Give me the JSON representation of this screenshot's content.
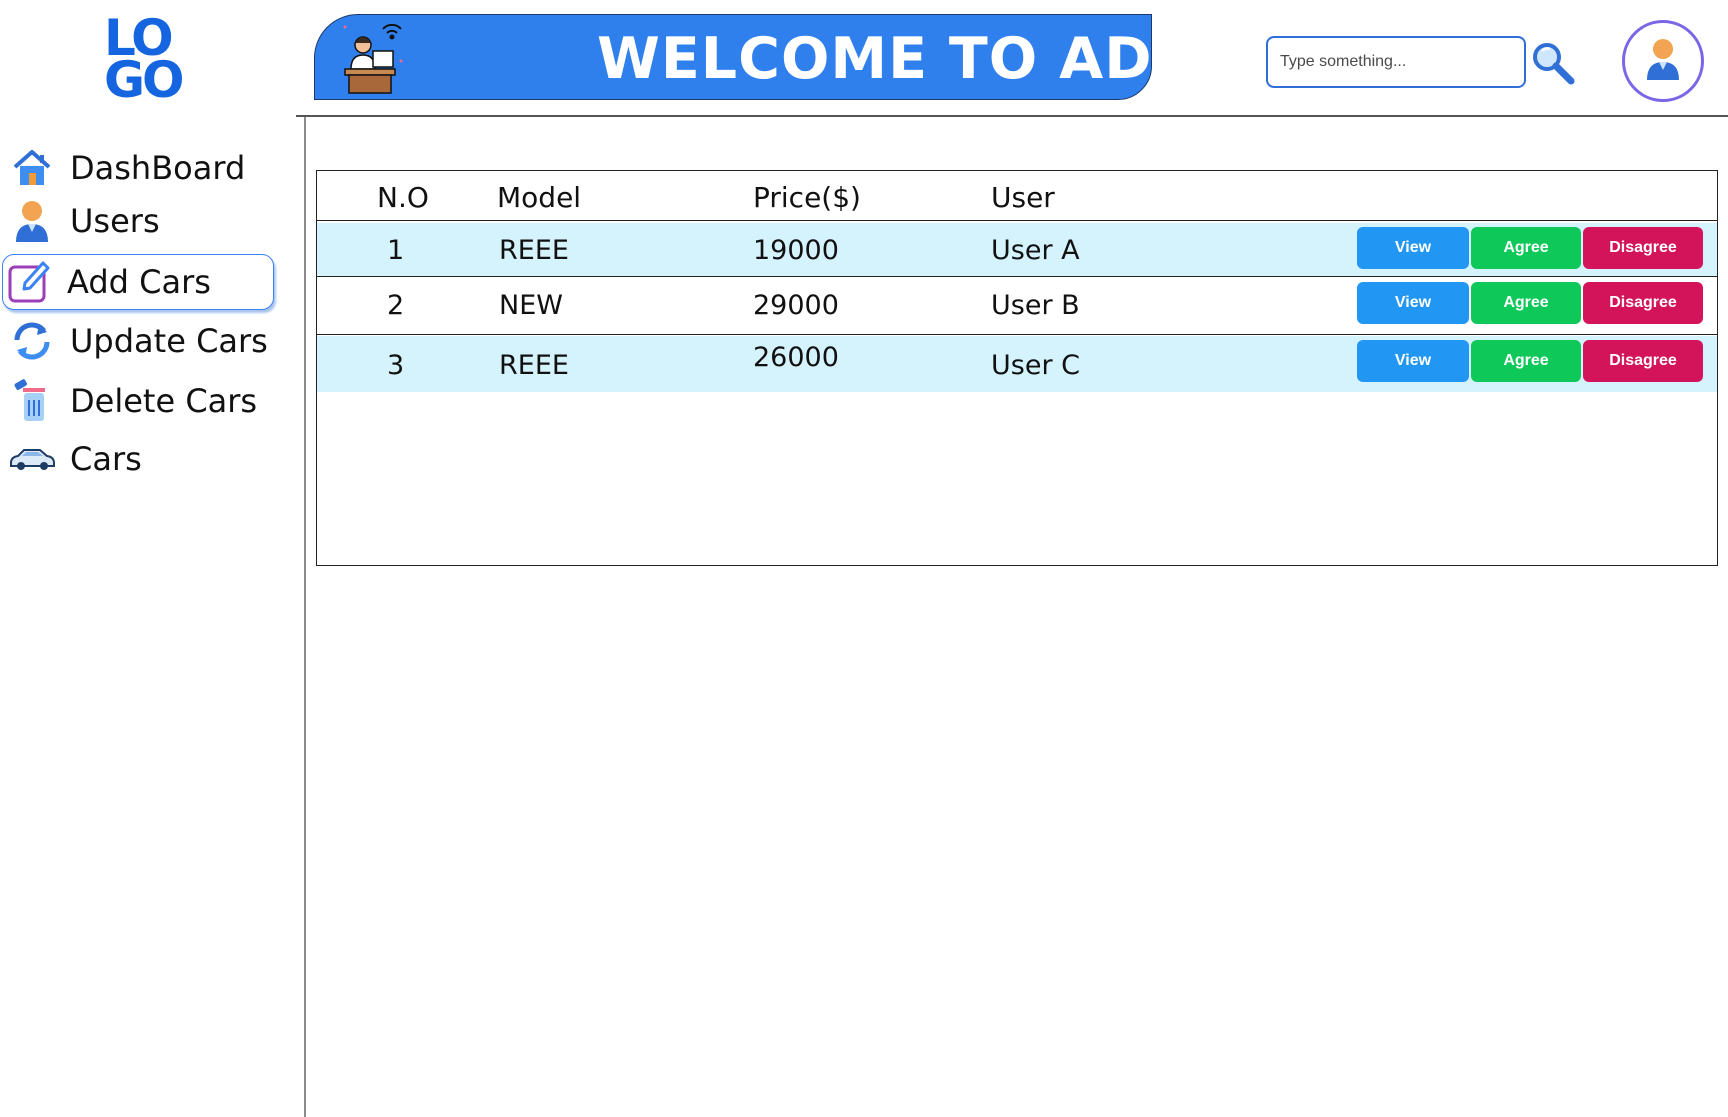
{
  "logo": {
    "line1": "LO",
    "line2": "GO"
  },
  "sidebar": {
    "items": [
      {
        "label": "DashBoard",
        "icon": "home-icon"
      },
      {
        "label": "Users",
        "icon": "user-icon"
      },
      {
        "label": "Add Cars",
        "icon": "edit-icon",
        "active": true
      },
      {
        "label": "Update Cars",
        "icon": "refresh-icon"
      },
      {
        "label": "Delete Cars",
        "icon": "trash-icon"
      },
      {
        "label": "Cars",
        "icon": "car-icon"
      }
    ]
  },
  "header": {
    "banner_text": "WELCOME TO ADMIN",
    "search_placeholder": "Type something...",
    "search_icon": "search-icon",
    "avatar_icon": "user-avatar-icon"
  },
  "table": {
    "columns": [
      "N.O",
      "Model",
      "Price($)",
      "User"
    ],
    "rows": [
      {
        "no": "1",
        "model": "REEE",
        "price": "19000",
        "user": "User A"
      },
      {
        "no": "2",
        "model": "NEW",
        "price": "29000",
        "user": "User B"
      },
      {
        "no": "3",
        "model": "REEE",
        "price": "26000",
        "user": "User C"
      }
    ],
    "actions": {
      "view": "View",
      "agree": "Agree",
      "disagree": "Disagree"
    }
  },
  "colors": {
    "brand": "#1565e0",
    "banner": "#2f80ed",
    "row_highlight": "#d5f3fd",
    "view": "#2196f3",
    "agree": "#0fc85a",
    "disagree": "#d4145a"
  }
}
